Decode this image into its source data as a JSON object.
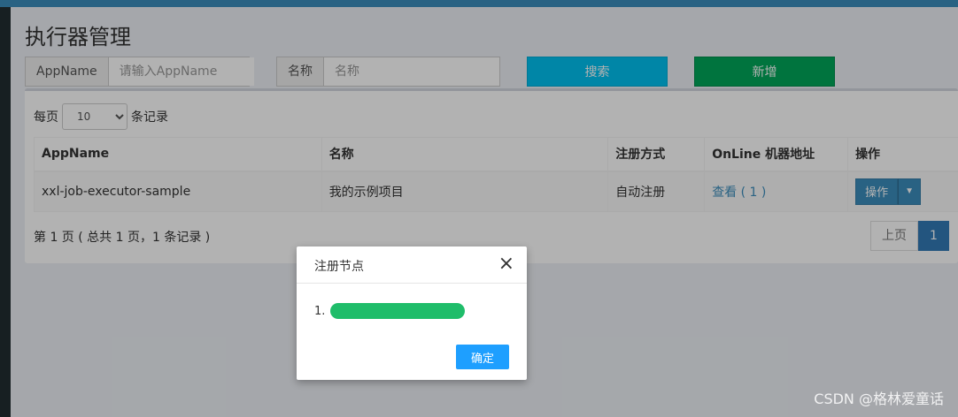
{
  "page": {
    "title": "执行器管理"
  },
  "search": {
    "appname_label": "AppName",
    "appname_placeholder": "请输入AppName",
    "name_label": "名称",
    "name_placeholder": "名称",
    "search_button": "搜索",
    "add_button": "新增"
  },
  "table": {
    "length_prefix": "每页",
    "length_value": "10",
    "length_suffix": "条记录",
    "headers": [
      "AppName",
      "名称",
      "注册方式",
      "OnLine 机器地址",
      "操作"
    ],
    "rows": [
      {
        "appname": "xxl-job-executor-sample",
        "name": "我的示例项目",
        "reg_type": "自动注册",
        "online": "查看 ( 1 )",
        "action": "操作"
      }
    ],
    "info": "第 1 页 ( 总共 1 页，1 条记录 )",
    "prev": "上页",
    "current_page": "1"
  },
  "modal": {
    "title": "注册节点",
    "close": "×",
    "item_index": "1.",
    "ok": "确定"
  },
  "watermark": "CSDN @格林爱童话",
  "colors": {
    "search_button": "#00c0ef",
    "add_button": "#00a65a",
    "primary": "#3c8dbc",
    "ok_button": "#1e9fff"
  }
}
